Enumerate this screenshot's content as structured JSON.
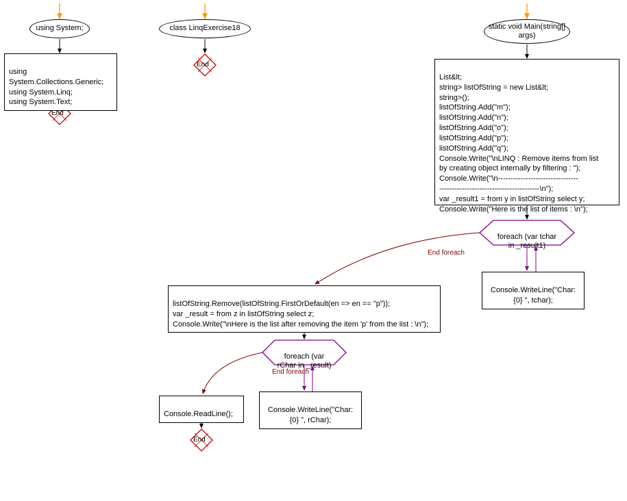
{
  "flowchart": {
    "col1": {
      "ellipse": "using System;",
      "box": "using System.Collections.Generic;\nusing System.Linq;\nusing System.Text;",
      "end": "End"
    },
    "col2": {
      "ellipse": "class LinqExercise18",
      "end": "End"
    },
    "col3": {
      "ellipse": "static void\nMain(string[] args)",
      "box1": "List&lt;\nstring> listOfString = new List&lt;\nstring>();\nlistOfString.Add(\"m\");\nlistOfString.Add(\"n\");\nlistOfString.Add(\"o\");\nlistOfString.Add(\"p\");\nlistOfString.Add(\"q\");\nConsole.Write(\"\\nLINQ : Remove items from list\nby creating object internally by filtering  : \");\nConsole.Write(\"\\n--------------------------------\n----------------------------------------\\n\");\nvar _result1 = from y in listOfString select y;\nConsole.Write(\"Here is the list of items : \\n\");",
      "hex1": "foreach (var tchar\nin _result1)",
      "hex1_end": "End foreach",
      "box_loop1": "Console.WriteLine(\"Char:\n{0} \", tchar);",
      "box2": "listOfString.Remove(listOfString.FirstOrDefault(en => en == \"p\"));\nvar _result = from z in listOfString select z;\nConsole.Write(\"\\nHere is the list after removing the item 'p' from the list : \\n\");",
      "hex2": "foreach (var\nrChar in _result)",
      "hex2_end": "End foreach",
      "box_loop2": "Console.WriteLine(\"Char:\n{0} \", rChar);",
      "box_readline": "Console.ReadLine();",
      "end": "End"
    }
  },
  "colors": {
    "arrow_orange": "#ff9900",
    "arrow_black": "#000000",
    "hex_purple": "#800080",
    "end_red": "#cc0000",
    "endforeach_text": "#800000"
  }
}
